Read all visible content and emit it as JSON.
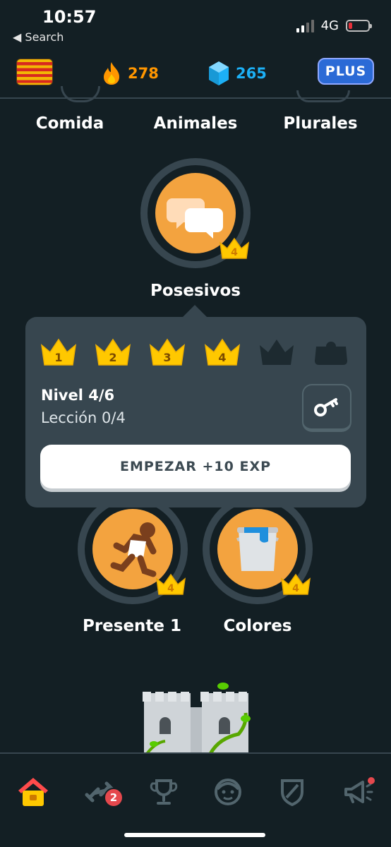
{
  "status_bar": {
    "time": "10:57",
    "back_label": "Search",
    "network": "4G"
  },
  "top_bar": {
    "streak": "278",
    "gems": "265",
    "plus_label": "PLUS"
  },
  "skills_top": [
    {
      "label": "Comida"
    },
    {
      "label": "Animales"
    },
    {
      "label": "Plurales"
    }
  ],
  "main_skill": {
    "label": "Posesivos",
    "crown_level": "4",
    "icon": "chat-bubbles-icon"
  },
  "popup": {
    "crowns": [
      "1",
      "2",
      "3",
      "4"
    ],
    "locked_crowns": 2,
    "level": "Nivel 4/6",
    "lesson": "Lección 0/4",
    "start_label": "EMPEZAR +10 EXP"
  },
  "skills_bottom": [
    {
      "label": "Presente 1",
      "crown_level": "4",
      "icon": "runner-icon"
    },
    {
      "label": "Colores",
      "crown_level": "4",
      "icon": "paint-bucket-icon"
    }
  ],
  "bottom_nav": {
    "items": [
      "home-icon",
      "practice-weights-icon",
      "trophy-icon",
      "characters-icon",
      "shield-icon",
      "megaphone-icon"
    ],
    "practice_badge": "2",
    "colors": {
      "accent": "#ff9600",
      "gems": "#1cb0f6",
      "orb": "#f3a33f",
      "background": "#131f24"
    }
  }
}
